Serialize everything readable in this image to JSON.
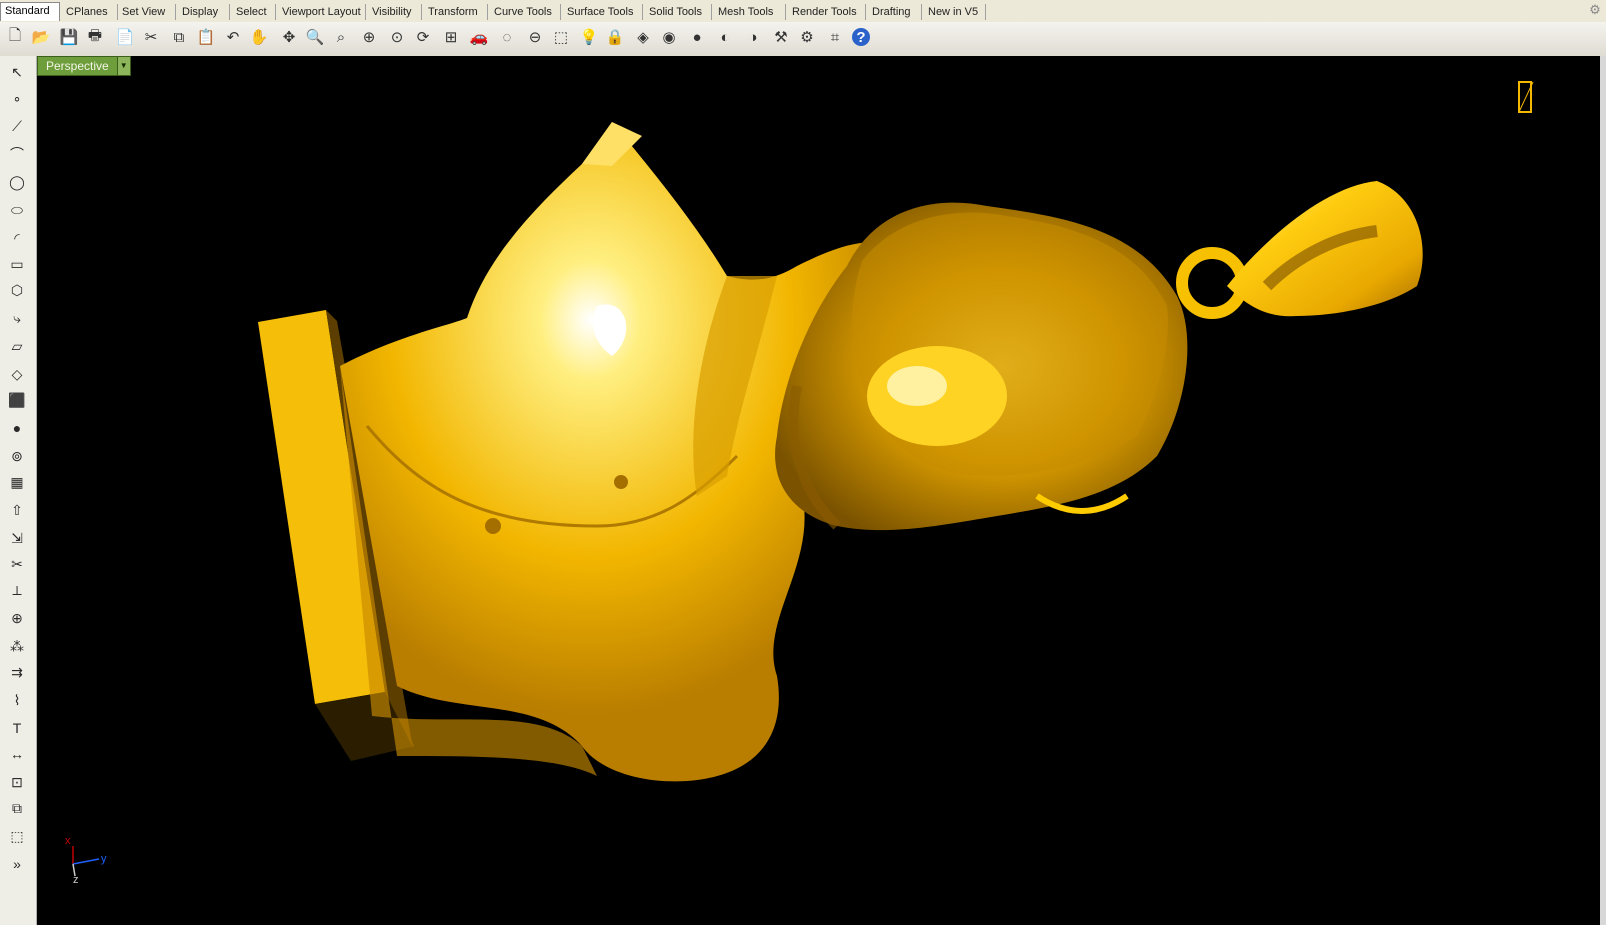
{
  "tabs": [
    {
      "label": "Standard",
      "active": true
    },
    {
      "label": "CPlanes"
    },
    {
      "label": "Set View"
    },
    {
      "label": "Display"
    },
    {
      "label": "Select"
    },
    {
      "label": "Viewport Layout"
    },
    {
      "label": "Visibility"
    },
    {
      "label": "Transform"
    },
    {
      "label": "Curve Tools"
    },
    {
      "label": "Surface Tools"
    },
    {
      "label": "Solid Tools"
    },
    {
      "label": "Mesh Tools"
    },
    {
      "label": "Render Tools"
    },
    {
      "label": "Drafting"
    },
    {
      "label": "New in V5"
    }
  ],
  "toolbar_icons": [
    "new-icon",
    "open-icon",
    "save-icon",
    "print-icon",
    "import-icon",
    "cut-icon",
    "copy-icon",
    "paste-icon",
    "undo-icon",
    "pan-hand-icon",
    "move-icon",
    "zoom-icon",
    "zoom-window-icon",
    "zoom-extents-icon",
    "zoom-selected-icon",
    "rotate-view-icon",
    "four-viewports-icon",
    "car-icon",
    "hide-icon",
    "lock-icon",
    "select-icon",
    "light-icon",
    "lock2-icon",
    "material-icon",
    "color-wheel-icon",
    "render-sphere-icon",
    "shaded-sphere-icon",
    "rendered-sphere-icon",
    "tool-icon",
    "options-gear-icon",
    "grid-snap-icon",
    "help-icon"
  ],
  "sidebar_icons": [
    "select-arrow-icon",
    "point-icon",
    "polyline-icon",
    "curve-icon",
    "circle-icon",
    "ellipse-icon",
    "arc-icon",
    "rectangle-icon",
    "polygon-icon",
    "fillet-curve-icon",
    "surface-icon",
    "loft-icon",
    "box-icon",
    "sphere-icon",
    "cylinder-icon",
    "mesh-icon",
    "extrude-icon",
    "transform-icon",
    "trim-icon",
    "split-icon",
    "boolean-icon",
    "array-icon",
    "offset-icon",
    "blend-icon",
    "text-icon",
    "dimension-icon",
    "group-icon",
    "layer-icon",
    "solid-edit-icon",
    "more-icon"
  ],
  "viewport": {
    "name": "Perspective",
    "background": "#000000",
    "model_color": "#f2b600"
  },
  "axes": {
    "x": "x",
    "y": "y",
    "z": "z"
  },
  "colors": {
    "tab_active": "#ffffff",
    "viewport_tab": "#6d9e3b",
    "axis_x": "#c00000",
    "axis_y": "#2060ff",
    "axis_z": "#cccccc"
  }
}
